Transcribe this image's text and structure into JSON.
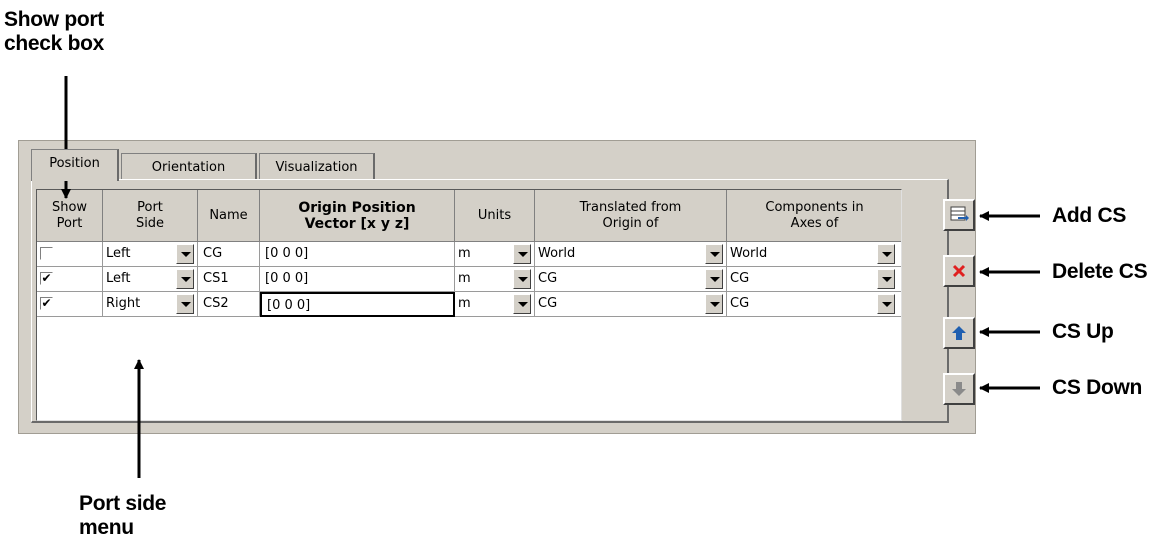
{
  "annotations": {
    "show_port": "Show port\ncheck box",
    "port_side": "Port side\nmenu",
    "add_cs": "Add CS",
    "delete_cs": "Delete CS",
    "cs_up": "CS Up",
    "cs_down": "CS Down"
  },
  "tabs": [
    {
      "label": "Position",
      "active": true
    },
    {
      "label": "Orientation",
      "active": false
    },
    {
      "label": "Visualization",
      "active": false
    }
  ],
  "table": {
    "headers": {
      "show_port": "Show\nPort",
      "port_side": "Port\nSide",
      "name": "Name",
      "origin": "Origin Position\nVector [x y z]",
      "units": "Units",
      "translated": "Translated from\nOrigin of",
      "components": "Components in\nAxes of"
    },
    "rows": [
      {
        "show_port": false,
        "port_side": "Left",
        "name": "CG",
        "origin": "[0 0 0]",
        "units": "m",
        "translated": "World",
        "components": "World"
      },
      {
        "show_port": true,
        "port_side": "Left",
        "name": "CS1",
        "origin": "[0 0 0]",
        "units": "m",
        "translated": "CG",
        "components": "CG"
      },
      {
        "show_port": true,
        "port_side": "Right",
        "name": "CS2",
        "origin": "[0 0 0]",
        "units": "m",
        "translated": "CG",
        "components": "CG"
      }
    ]
  },
  "buttons": {
    "add_icon": "add-row-icon",
    "delete_icon": "red-x-icon",
    "up_icon": "blue-up-arrow-icon",
    "down_icon": "gray-down-arrow-icon"
  },
  "colors": {
    "panel": "#d4d0c8",
    "delete_red": "#e02020",
    "up_blue": "#1f5fb0",
    "down_gray": "#8a8a8a"
  }
}
